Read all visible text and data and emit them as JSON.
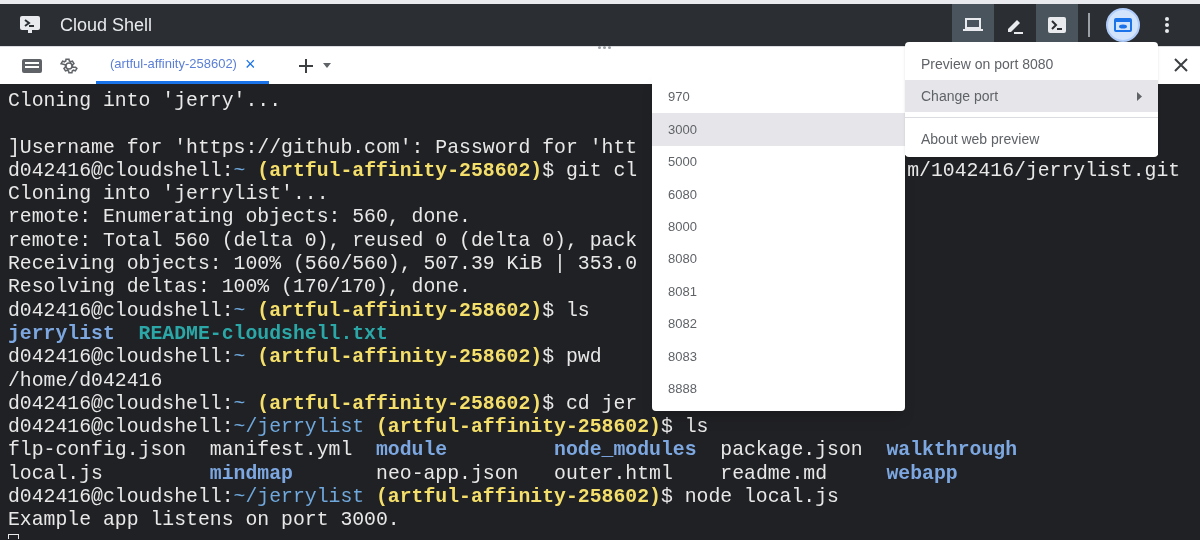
{
  "window": {
    "title": "Cloud Shell"
  },
  "toolbar": [
    {
      "kind": "laptop",
      "selected": true
    },
    {
      "kind": "pencil",
      "selected": false
    },
    {
      "kind": "terminal",
      "selected": true
    },
    {
      "kind": "divider"
    },
    {
      "kind": "preview",
      "selected": true
    },
    {
      "kind": "more",
      "selected": false
    }
  ],
  "tabs": [
    {
      "label": "(artful-affinity-258602)",
      "selected": true,
      "close": "×"
    }
  ],
  "terminal": {
    "lines": [
      [
        {
          "kind": "text",
          "text": "Cloning into 'jerry'..."
        }
      ],
      [
        {
          "kind": "blank"
        }
      ],
      [
        {
          "kind": "text",
          "text": "]Username for 'https://github.com': Password for 'htt"
        }
      ],
      [
        {
          "kind": "text",
          "text": "d042416@cloudshell:"
        },
        {
          "kind": "path",
          "text": "~ "
        },
        {
          "kind": "project",
          "text": "(artful-affinity-258602)"
        },
        {
          "kind": "text",
          "text": "$ git cl"
        },
        {
          "kind": "tail",
          "text": "m/1042416/jerrylist.git"
        }
      ],
      [
        {
          "kind": "text",
          "text": "Cloning into 'jerrylist'..."
        }
      ],
      [
        {
          "kind": "text",
          "text": "remote: Enumerating objects: 560, done."
        }
      ],
      [
        {
          "kind": "text",
          "text": "remote: Total 560 (delta 0), reused 0 (delta 0), pack"
        }
      ],
      [
        {
          "kind": "text",
          "text": "Receiving objects: 100% (560/560), 507.39 KiB | 353.0"
        }
      ],
      [
        {
          "kind": "text",
          "text": "Resolving deltas: 100% (170/170), done."
        }
      ],
      [
        {
          "kind": "text",
          "text": "d042416@cloudshell:"
        },
        {
          "kind": "path",
          "text": "~ "
        },
        {
          "kind": "project",
          "text": "(artful-affinity-258602)"
        },
        {
          "kind": "text",
          "text": "$ ls"
        }
      ],
      [
        {
          "kind": "dir",
          "text": "jerrylist  "
        },
        {
          "kind": "readme",
          "text": "README-cloudshell.txt"
        }
      ],
      [
        {
          "kind": "text",
          "text": "d042416@cloudshell:"
        },
        {
          "kind": "path",
          "text": "~ "
        },
        {
          "kind": "project",
          "text": "(artful-affinity-258602)"
        },
        {
          "kind": "text",
          "text": "$ pwd"
        }
      ],
      [
        {
          "kind": "text",
          "text": "/home/d042416"
        }
      ],
      [
        {
          "kind": "text",
          "text": "d042416@cloudshell:"
        },
        {
          "kind": "path",
          "text": "~ "
        },
        {
          "kind": "project",
          "text": "(artful-affinity-258602)"
        },
        {
          "kind": "text",
          "text": "$ cd jer"
        }
      ],
      [
        {
          "kind": "text",
          "text": "d042416@cloudshell:"
        },
        {
          "kind": "path",
          "text": "~/jerrylist "
        },
        {
          "kind": "project",
          "text": "(artful-affinity-258602)"
        },
        {
          "kind": "text",
          "text": "$ ls"
        }
      ],
      [
        {
          "kind": "text",
          "text": "flp-config.json  manifest.yml  "
        },
        {
          "kind": "dir",
          "text": "module         "
        },
        {
          "kind": "dir",
          "text": "node_modules"
        },
        {
          "kind": "text",
          "text": "  package.json  "
        },
        {
          "kind": "dir",
          "text": "walkthrough"
        }
      ],
      [
        {
          "kind": "text",
          "text": "local.js         "
        },
        {
          "kind": "dir",
          "text": "mindmap"
        },
        {
          "kind": "text",
          "text": "       neo-app.json   outer.html    readme.md     "
        },
        {
          "kind": "dir",
          "text": "webapp"
        }
      ],
      [
        {
          "kind": "text",
          "text": "d042416@cloudshell:"
        },
        {
          "kind": "path",
          "text": "~/jerrylist "
        },
        {
          "kind": "project",
          "text": "(artful-affinity-258602)"
        },
        {
          "kind": "text",
          "text": "$ node local.js"
        }
      ],
      [
        {
          "kind": "text",
          "text": "Example app listens on port 3000."
        }
      ],
      [
        {
          "kind": "cursor"
        }
      ]
    ]
  },
  "preview_menu": {
    "items": [
      {
        "kind": "item",
        "label": "Preview on port 8080",
        "selected": false
      },
      {
        "kind": "submenu",
        "label": "Change port",
        "selected": true
      },
      {
        "kind": "divider"
      },
      {
        "kind": "item",
        "label": "About web preview",
        "selected": false
      }
    ]
  },
  "port_menu": {
    "items": [
      {
        "label": "970",
        "selected": false
      },
      {
        "label": "3000",
        "selected": true
      },
      {
        "label": "5000",
        "selected": false
      },
      {
        "label": "6080",
        "selected": false
      },
      {
        "label": "8000",
        "selected": false
      },
      {
        "label": "8080",
        "selected": false
      },
      {
        "label": "8081",
        "selected": false
      },
      {
        "label": "8082",
        "selected": false
      },
      {
        "label": "8083",
        "selected": false
      },
      {
        "label": "8888",
        "selected": false
      }
    ]
  }
}
